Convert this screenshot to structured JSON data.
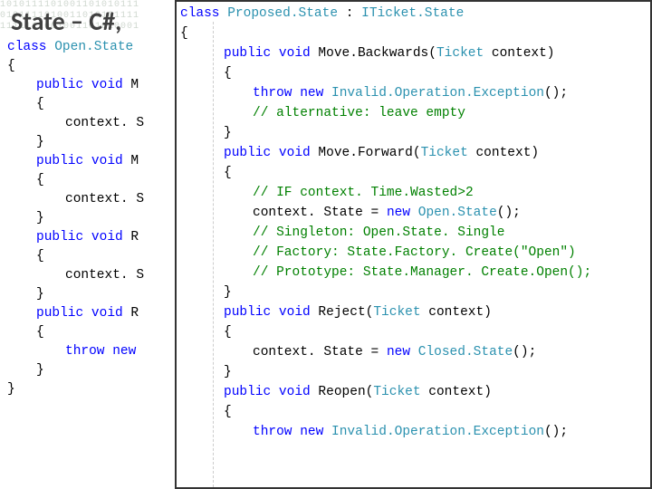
{
  "title": "State – C#,",
  "binary": "1010111101001101010111\n0101111010011010101111\n1111111001001101010001",
  "left_code": [
    [
      {
        "cls": "kw",
        "t": "class"
      },
      {
        "cls": "txt",
        "t": " "
      },
      {
        "cls": "type",
        "t": "Open.State"
      }
    ],
    [
      {
        "cls": "txt",
        "t": "{"
      }
    ],
    [
      {
        "cls": "ind1 kw",
        "t": "public"
      },
      {
        "cls": "txt",
        "t": " "
      },
      {
        "cls": "kw",
        "t": "void"
      },
      {
        "cls": "txt",
        "t": " M"
      }
    ],
    [
      {
        "cls": "ind1 txt",
        "t": "{"
      }
    ],
    [
      {
        "cls": "ind2 txt",
        "t": "context. S"
      }
    ],
    [
      {
        "cls": "ind1 txt",
        "t": "}"
      }
    ],
    [
      {
        "cls": "ind1 kw",
        "t": "public"
      },
      {
        "cls": "txt",
        "t": " "
      },
      {
        "cls": "kw",
        "t": "void"
      },
      {
        "cls": "txt",
        "t": " M"
      }
    ],
    [
      {
        "cls": "ind1 txt",
        "t": "{"
      }
    ],
    [
      {
        "cls": "ind2 txt",
        "t": "context. S"
      }
    ],
    [
      {
        "cls": "ind1 txt",
        "t": "}"
      }
    ],
    [
      {
        "cls": "ind1 kw",
        "t": "public"
      },
      {
        "cls": "txt",
        "t": " "
      },
      {
        "cls": "kw",
        "t": "void"
      },
      {
        "cls": "txt",
        "t": " R"
      }
    ],
    [
      {
        "cls": "ind1 txt",
        "t": "{"
      }
    ],
    [
      {
        "cls": "ind2 txt",
        "t": "context. S"
      }
    ],
    [
      {
        "cls": "ind1 txt",
        "t": "}"
      }
    ],
    [
      {
        "cls": "ind1 kw",
        "t": "public"
      },
      {
        "cls": "txt",
        "t": " "
      },
      {
        "cls": "kw",
        "t": "void"
      },
      {
        "cls": "txt",
        "t": " R"
      }
    ],
    [
      {
        "cls": "ind1 txt",
        "t": "{"
      }
    ],
    [
      {
        "cls": "ind2 kw",
        "t": "throw"
      },
      {
        "cls": "txt",
        "t": " "
      },
      {
        "cls": "kw",
        "t": "new"
      }
    ],
    [
      {
        "cls": "ind1 txt",
        "t": "}"
      }
    ],
    [
      {
        "cls": "txt",
        "t": "}"
      }
    ]
  ],
  "right_code": [
    [
      {
        "cls": "kw",
        "t": "class"
      },
      {
        "cls": "txt",
        "t": " "
      },
      {
        "cls": "type",
        "t": "Proposed.State"
      },
      {
        "cls": "txt",
        "t": " : "
      },
      {
        "cls": "type",
        "t": "ITicket.State"
      }
    ],
    [
      {
        "cls": "txt",
        "t": "{"
      }
    ],
    [
      {
        "cls": "r-ind1 kw",
        "t": "public"
      },
      {
        "cls": "txt",
        "t": " "
      },
      {
        "cls": "kw",
        "t": "void"
      },
      {
        "cls": "txt",
        "t": " Move.Backwards("
      },
      {
        "cls": "type",
        "t": "Ticket"
      },
      {
        "cls": "txt",
        "t": " context)"
      }
    ],
    [
      {
        "cls": "r-ind1 txt",
        "t": "{"
      }
    ],
    [
      {
        "cls": "r-ind2 kw",
        "t": "throw"
      },
      {
        "cls": "txt",
        "t": " "
      },
      {
        "cls": "kw",
        "t": "new"
      },
      {
        "cls": "txt",
        "t": " "
      },
      {
        "cls": "type",
        "t": "Invalid.Operation.Exception"
      },
      {
        "cls": "txt",
        "t": "();"
      }
    ],
    [
      {
        "cls": "r-ind2 cm",
        "t": "// alternative: leave empty"
      }
    ],
    [
      {
        "cls": "r-ind1 txt",
        "t": "}"
      }
    ],
    [
      {
        "cls": "r-ind1 kw",
        "t": "public"
      },
      {
        "cls": "txt",
        "t": " "
      },
      {
        "cls": "kw",
        "t": "void"
      },
      {
        "cls": "txt",
        "t": " Move.Forward("
      },
      {
        "cls": "type",
        "t": "Ticket"
      },
      {
        "cls": "txt",
        "t": " context)"
      }
    ],
    [
      {
        "cls": "r-ind1 txt",
        "t": "{"
      }
    ],
    [
      {
        "cls": "r-ind2 cm",
        "t": "// IF context. Time.Wasted>2"
      }
    ],
    [
      {
        "cls": "r-ind2 txt",
        "t": "context. State = "
      },
      {
        "cls": "kw",
        "t": "new"
      },
      {
        "cls": "txt",
        "t": " "
      },
      {
        "cls": "type",
        "t": "Open.State"
      },
      {
        "cls": "txt",
        "t": "();"
      }
    ],
    [
      {
        "cls": "r-ind2 cm",
        "t": "// Singleton: Open.State. Single"
      }
    ],
    [
      {
        "cls": "r-ind2 cm",
        "t": "// Factory: State.Factory. Create(\"Open\")"
      }
    ],
    [
      {
        "cls": "r-ind2 cm",
        "t": "// Prototype: State.Manager. Create.Open();"
      }
    ],
    [
      {
        "cls": "r-ind1 txt",
        "t": "}"
      }
    ],
    [
      {
        "cls": "r-ind1 kw",
        "t": "public"
      },
      {
        "cls": "txt",
        "t": " "
      },
      {
        "cls": "kw",
        "t": "void"
      },
      {
        "cls": "txt",
        "t": " Reject("
      },
      {
        "cls": "type",
        "t": "Ticket"
      },
      {
        "cls": "txt",
        "t": " context)"
      }
    ],
    [
      {
        "cls": "r-ind1 txt",
        "t": "{"
      }
    ],
    [
      {
        "cls": "r-ind2 txt",
        "t": "context. State = "
      },
      {
        "cls": "kw",
        "t": "new"
      },
      {
        "cls": "txt",
        "t": " "
      },
      {
        "cls": "type",
        "t": "Closed.State"
      },
      {
        "cls": "txt",
        "t": "();"
      }
    ],
    [
      {
        "cls": "r-ind1 txt",
        "t": "}"
      }
    ],
    [
      {
        "cls": "r-ind1 kw",
        "t": "public"
      },
      {
        "cls": "txt",
        "t": " "
      },
      {
        "cls": "kw",
        "t": "void"
      },
      {
        "cls": "txt",
        "t": " Reopen("
      },
      {
        "cls": "type",
        "t": "Ticket"
      },
      {
        "cls": "txt",
        "t": " context)"
      }
    ],
    [
      {
        "cls": "r-ind1 txt",
        "t": "{"
      }
    ],
    [
      {
        "cls": "r-ind2 kw",
        "t": "throw"
      },
      {
        "cls": "txt",
        "t": " "
      },
      {
        "cls": "kw",
        "t": "new"
      },
      {
        "cls": "txt",
        "t": " "
      },
      {
        "cls": "type",
        "t": "Invalid.Operation.Exception"
      },
      {
        "cls": "txt",
        "t": "();"
      }
    ]
  ]
}
